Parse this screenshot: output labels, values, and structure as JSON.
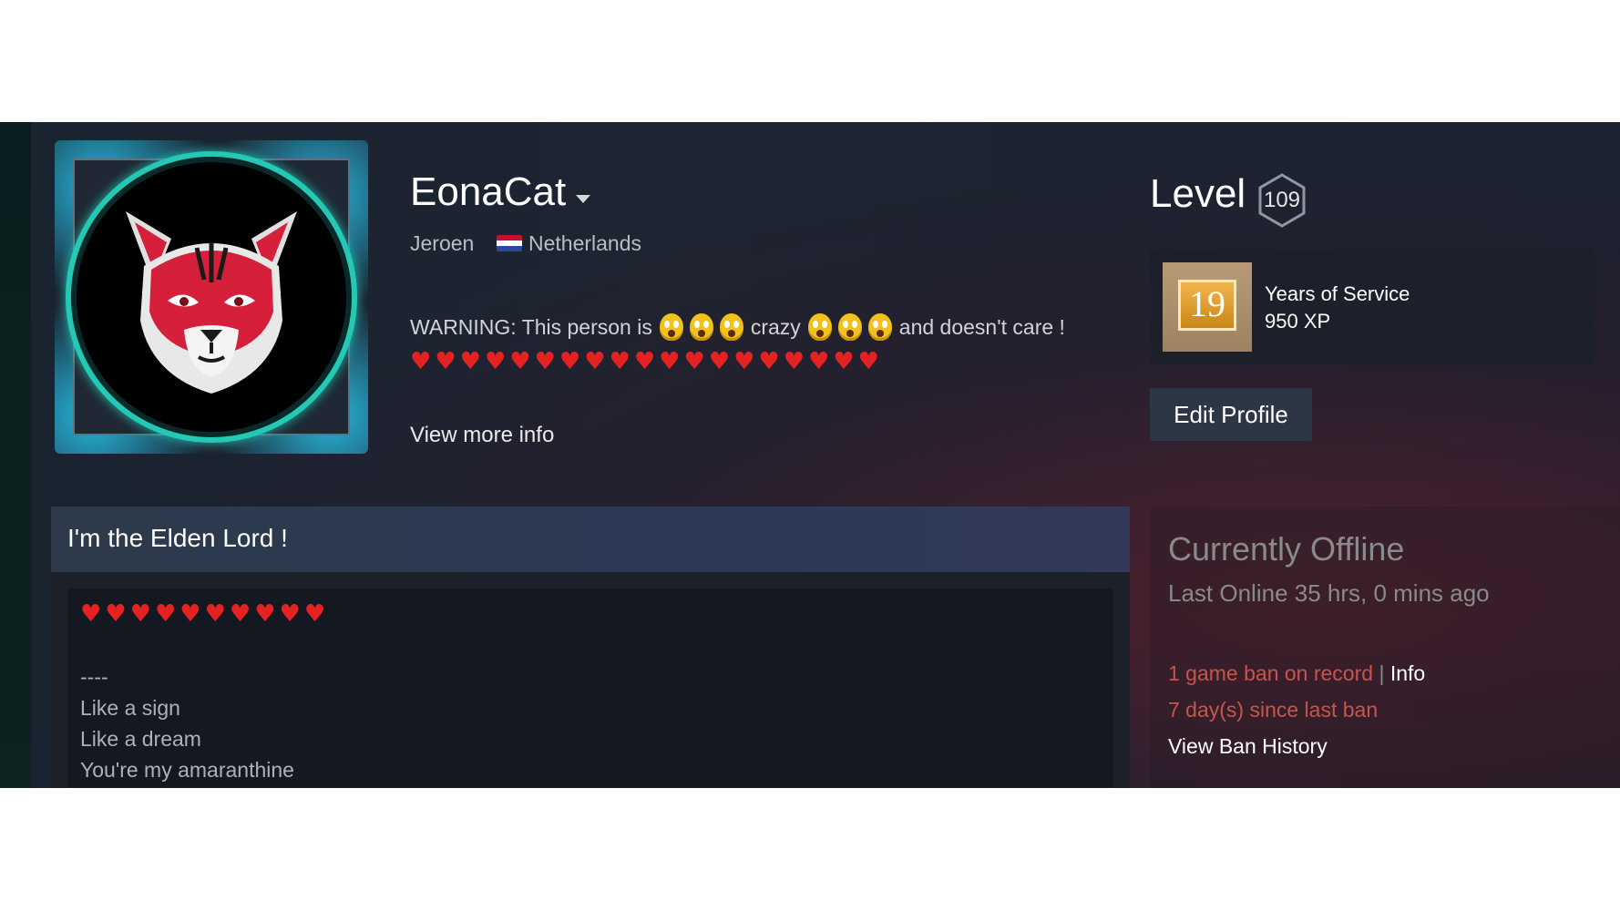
{
  "profile": {
    "persona_name": "EonaCat",
    "real_name": "Jeroen",
    "country": "Netherlands",
    "summary_text": {
      "part1": "WARNING: This person is",
      "part2": "crazy",
      "part3": "and doesn't care !"
    },
    "summary_hearts": 19,
    "view_more": "View more info"
  },
  "level": {
    "label": "Level",
    "value": "109"
  },
  "badge": {
    "title": "Years of Service",
    "xp": "950 XP",
    "number": "19"
  },
  "edit_profile": "Edit Profile",
  "custom_summary": {
    "title": "I'm the Elden Lord !",
    "hearts": 10,
    "lines": [
      "----",
      "Like a sign",
      "Like a dream",
      "You're my amaranthine"
    ]
  },
  "status": {
    "state": "Currently Offline",
    "last_online": "Last Online 35 hrs, 0 mins ago",
    "game_ban": "1 game ban on record",
    "separator": "|",
    "info_link": "Info",
    "since_ban": "7 day(s) since last ban",
    "ban_history": "View Ban History"
  },
  "colors": {
    "ban_red": "#c9544d",
    "heart_red": "#e52222",
    "frame_teal": "#23c9b4"
  },
  "icons": {
    "dropdown": "chevron-down-icon",
    "flag": "netherlands-flag-icon",
    "level": "hexagon-level-icon",
    "emoji": "crazy-face-emoji-icon",
    "heart": "heart-emoji-icon"
  }
}
